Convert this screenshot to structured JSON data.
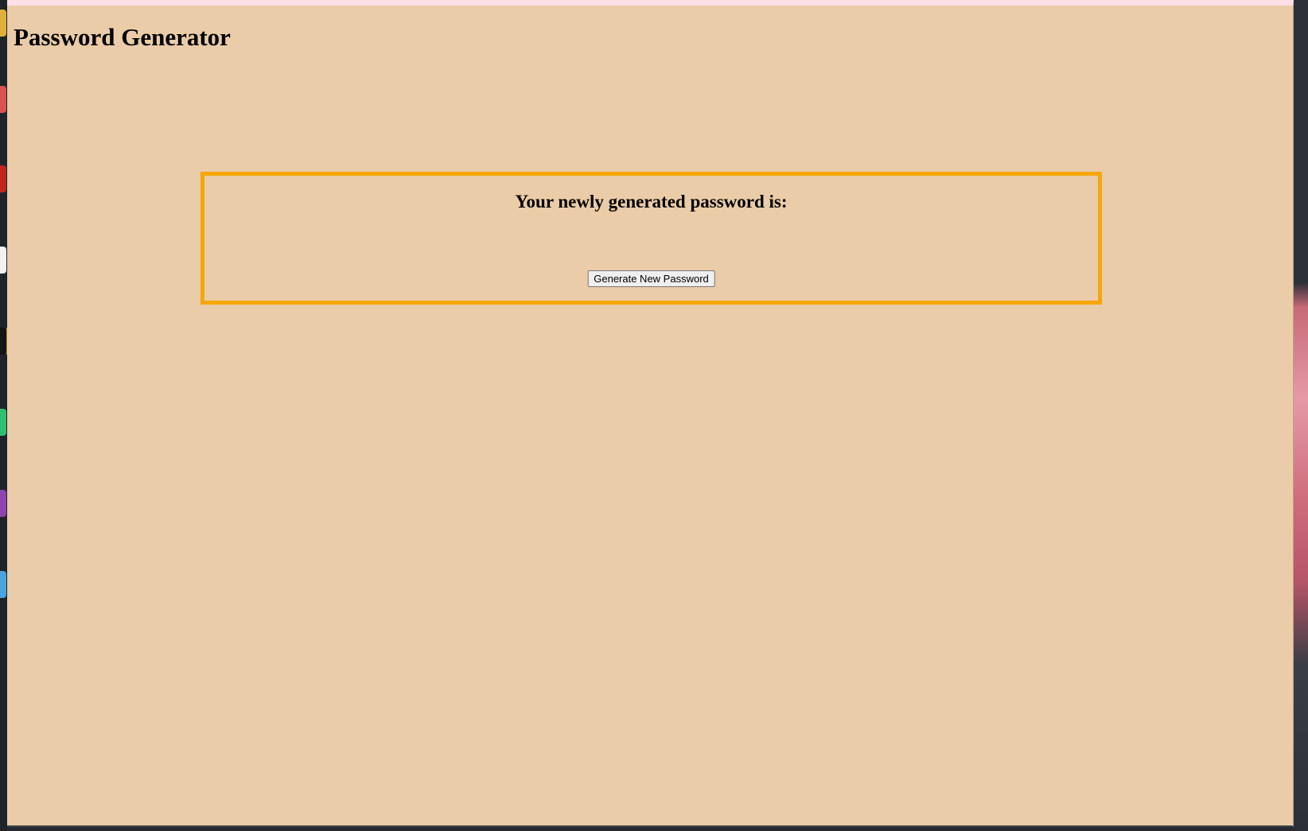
{
  "page": {
    "title": "Password Generator"
  },
  "panel": {
    "heading": "Your newly generated password is:",
    "password": "",
    "generate_button_label": "Generate New Password"
  },
  "colors": {
    "page_background": "#eacca8",
    "panel_border": "#f6a609",
    "top_bar": "#fbe0e8"
  }
}
